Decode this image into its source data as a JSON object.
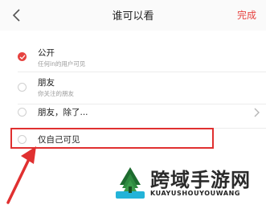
{
  "header": {
    "title": "谁可以看",
    "done_label": "完成"
  },
  "options": [
    {
      "title": "公开",
      "subtitle": "任何in的用户可见",
      "selected": true
    },
    {
      "title": "朋友",
      "subtitle": "你关注的朋友",
      "selected": false
    },
    {
      "title": "朋友，除了...",
      "subtitle": "",
      "selected": false,
      "has_chevron": true
    },
    {
      "title": "仅自己可见",
      "subtitle": "",
      "selected": false,
      "highlighted": true
    }
  ],
  "watermark": {
    "title": "跨域手游网",
    "subtitle": "KUAYUSHOUYOUWANG"
  },
  "colors": {
    "accent": "#e64340",
    "annotation": "#e03030"
  }
}
